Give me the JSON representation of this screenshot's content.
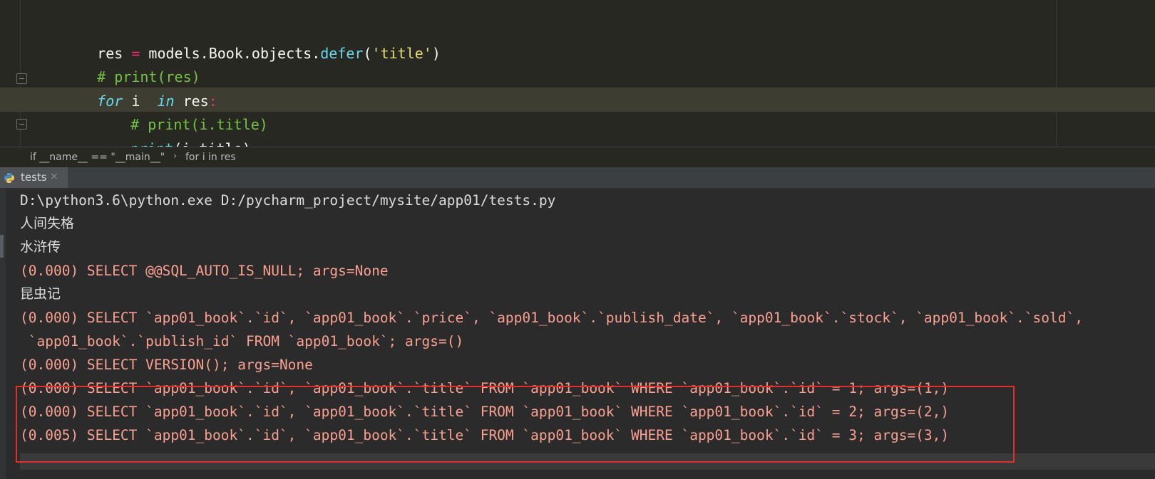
{
  "editor": {
    "lines": [
      {
        "parts": [
          {
            "t": "res ",
            "c": "plain"
          },
          {
            "t": "=",
            "c": "op"
          },
          {
            "t": " models.Book.objects.",
            "c": "plain"
          },
          {
            "t": "defer",
            "c": "fn"
          },
          {
            "t": "(",
            "c": "plain"
          },
          {
            "t": "'title'",
            "c": "str"
          },
          {
            "t": ")",
            "c": "plain"
          }
        ]
      },
      {
        "parts": [
          {
            "t": "# print(res)",
            "c": "cmt"
          }
        ]
      },
      {
        "parts": [
          {
            "t": "for",
            "c": "kw"
          },
          {
            "t": " i  ",
            "c": "plain"
          },
          {
            "t": "in",
            "c": "kw"
          },
          {
            "t": " res",
            "c": "plain"
          },
          {
            "t": ":",
            "c": "op"
          }
        ]
      },
      {
        "parts": [
          {
            "t": "# print(i.title)",
            "c": "cmt"
          }
        ]
      },
      {
        "parts": [
          {
            "t": "print",
            "c": "fn"
          },
          {
            "t": "(i.title)",
            "c": "plain"
          }
        ]
      }
    ]
  },
  "breadcrumb": {
    "item1": "if __name__ == \"__main__\"",
    "separator": "›",
    "item2": "for i in res"
  },
  "run_tab": {
    "label": "tests",
    "close": "×",
    "icon": "python-icon"
  },
  "console": {
    "lines": [
      {
        "text": "D:\\python3.6\\python.exe D:/pycharm_project/mysite/app01/tests.py",
        "style": "plain"
      },
      {
        "text": "人间失格",
        "style": "cn"
      },
      {
        "text": "水浒传",
        "style": "cn"
      },
      {
        "text": "(0.000) SELECT @@SQL_AUTO_IS_NULL; args=None",
        "style": "sql"
      },
      {
        "text": "昆虫记",
        "style": "cn"
      },
      {
        "text": "(0.000) SELECT `app01_book`.`id`, `app01_book`.`price`, `app01_book`.`publish_date`, `app01_book`.`stock`, `app01_book`.`sold`,",
        "style": "sql"
      },
      {
        "text": " `app01_book`.`publish_id` FROM `app01_book`; args=()",
        "style": "sql"
      },
      {
        "text": "(0.000) SELECT VERSION(); args=None",
        "style": "sql"
      },
      {
        "text": "(0.000) SELECT `app01_book`.`id`, `app01_book`.`title` FROM `app01_book` WHERE `app01_book`.`id` = 1; args=(1,)",
        "style": "sql"
      },
      {
        "text": "(0.000) SELECT `app01_book`.`id`, `app01_book`.`title` FROM `app01_book` WHERE `app01_book`.`id` = 2; args=(2,)",
        "style": "sql"
      },
      {
        "text": "(0.005) SELECT `app01_book`.`id`, `app01_book`.`title` FROM `app01_book` WHERE `app01_book`.`id` = 3; args=(3,)",
        "style": "sql"
      }
    ]
  },
  "colors": {
    "editor_bg": "#272822",
    "console_bg": "#2b2b2b",
    "sql_text": "#f9a090",
    "highlight_border": "#e0302b",
    "comment": "#75c342",
    "keyword": "#66d9ef"
  }
}
